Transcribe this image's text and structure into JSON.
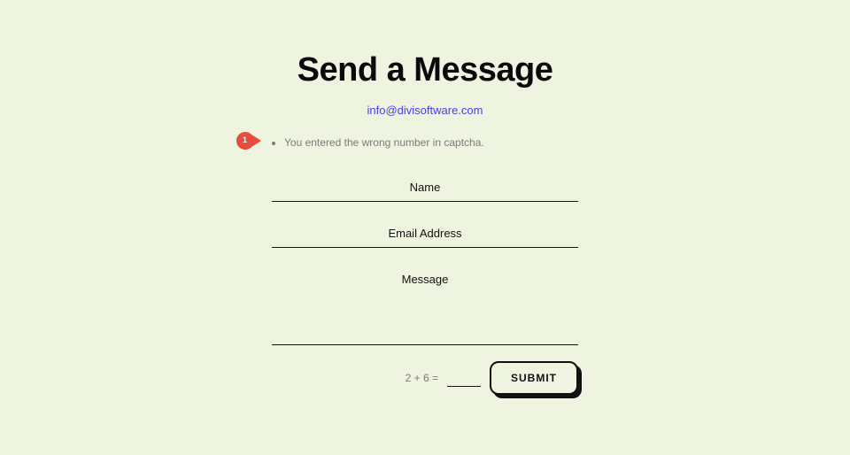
{
  "header": {
    "title": "Send a Message",
    "email": "info@divisoftware.com"
  },
  "errors": {
    "items": [
      "You entered the wrong number in captcha."
    ]
  },
  "form": {
    "name": {
      "placeholder": "Name",
      "value": ""
    },
    "email": {
      "placeholder": "Email Address",
      "value": ""
    },
    "message": {
      "placeholder": "Message",
      "value": ""
    },
    "captcha": {
      "label": "2 + 6 =",
      "value": ""
    },
    "submit_label": "SUBMIT"
  },
  "annotation": {
    "number": "1"
  }
}
